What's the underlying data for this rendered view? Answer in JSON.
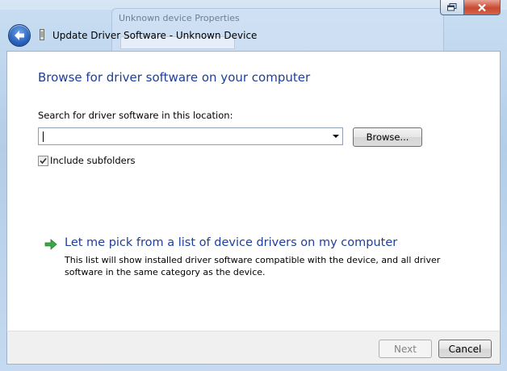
{
  "background": {
    "ghost_title": "Unknown device Properties"
  },
  "window": {
    "title": "Update Driver Software - Unknown Device",
    "restore_icon": "restore-icon",
    "close_icon": "close-icon"
  },
  "main": {
    "heading": "Browse for driver software on your computer",
    "search_label": "Search for driver software in this location:",
    "search_value": "",
    "browse_label": "Browse...",
    "include_subfolders_label": "Include subfolders",
    "include_subfolders_checked": true,
    "pick_link_title": "Let me pick from a list of device drivers on my computer",
    "pick_link_desc": "This list will show installed driver software compatible with the device, and all driver software in the same category as the device."
  },
  "footer": {
    "next_label": "Next",
    "next_enabled": false,
    "cancel_label": "Cancel"
  },
  "colors": {
    "heading_blue": "#1e3f9a",
    "close_red": "#c84a31",
    "link_arrow_green": "#3aa845"
  }
}
